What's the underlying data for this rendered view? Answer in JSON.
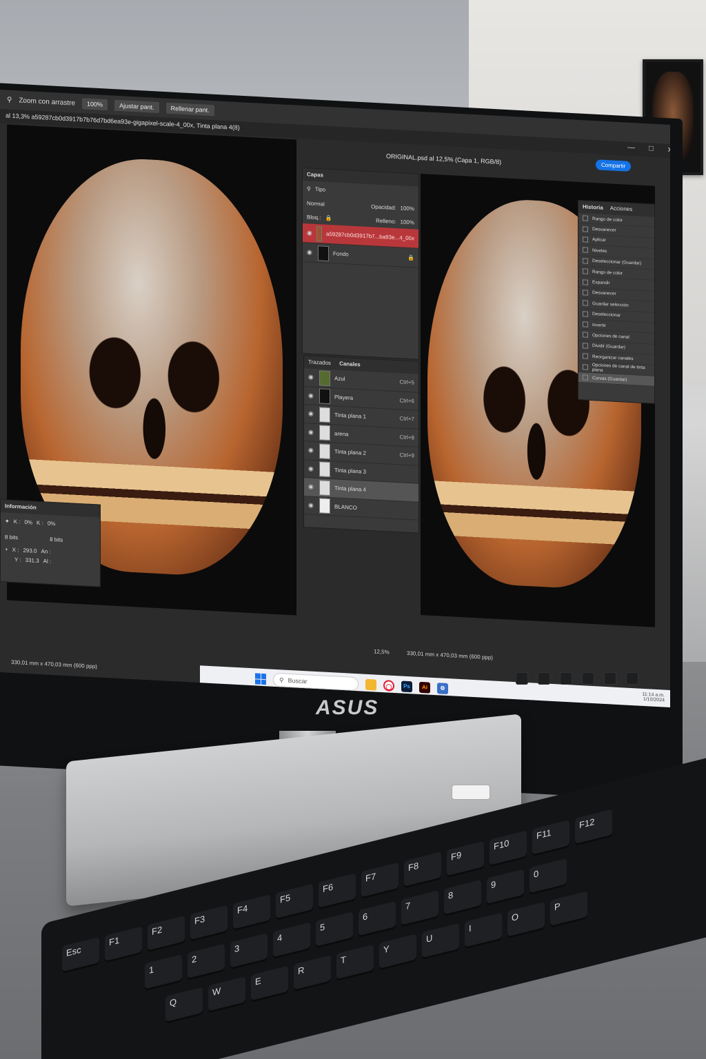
{
  "ps": {
    "options": {
      "zoom_drag_label": "Zoom con arrastre",
      "zoom_value": "100%",
      "fit_label": "Ajustar pant.",
      "fill_label": "Rellenar pant."
    },
    "tab_left": "al 13,3% a59287cb0d3917b7b76d7bd6ea93e-gigapixel-scale-4_00x, Tinta plana 4(8)",
    "doc_title": "ORIGINAL.psd al 12,5% (Capa 1, RGB/8)",
    "share_label": "Compartir",
    "layers": {
      "title": "Capas",
      "filter": "Tipo",
      "blend": "Normal",
      "opacity_label": "Opacidad:",
      "opacity_value": "100%",
      "lock_label": "Bloq.:",
      "fill_label": "Relleno:",
      "fill_value": "100%",
      "items": [
        {
          "name": "a59287cb0d3917b7...ba93e...4_00x"
        },
        {
          "name": "Fondo"
        }
      ]
    },
    "channels": {
      "tabs": [
        "Trazados",
        "Canales"
      ],
      "items": [
        {
          "name": "Azul",
          "shortcut": "Ctrl+5"
        },
        {
          "name": "Playera",
          "shortcut": "Ctrl+6"
        },
        {
          "name": "Tinta plana 1",
          "shortcut": "Ctrl+7"
        },
        {
          "name": "arena",
          "shortcut": "Ctrl+8"
        },
        {
          "name": "Tinta plana 2",
          "shortcut": "Ctrl+9"
        },
        {
          "name": "Tinta plana 3",
          "shortcut": ""
        },
        {
          "name": "Tinta plana 4",
          "shortcut": ""
        },
        {
          "name": "BLANCO",
          "shortcut": ""
        }
      ]
    },
    "history": {
      "tabs": [
        "Historia",
        "Acciones"
      ],
      "items": [
        "Rango de color",
        "Desvanecer",
        "Aplicar",
        "Niveles",
        "Deseleccionar (Guardar)",
        "Rango de color",
        "Expandir",
        "Desvanecer",
        "Guardar selección",
        "Deseleccionar",
        "Invertir",
        "Opciones de canal",
        "Dividir (Guardar)",
        "Reorganizar canales",
        "Opciones de canal de tinta plana",
        "Curvas (Guardar)"
      ]
    },
    "info": {
      "title": "Información",
      "k1": "K :",
      "k1_value": "0%",
      "k2": "K :",
      "k2_value": "0%",
      "bits1": "8 bits",
      "bits2": "8 bits",
      "x_label": "X :",
      "x_value": "293.0",
      "y_label": "Y :",
      "y_value": "331.3",
      "an_label": "An :",
      "al_label": "Al :"
    },
    "status_left": "330,01 mm x 470,03 mm (600 ppp)",
    "status_zoom": "12,5%",
    "status_right": "330,01 mm x 470,03 mm (600 ppp)"
  },
  "taskbar": {
    "search_placeholder": "Buscar",
    "apps": [
      "Ps",
      "Ai"
    ],
    "time": "11:14 a.m.",
    "date": "1/10/2024"
  },
  "hardware": {
    "brand": "ASUS"
  },
  "keyboard": {
    "row1": [
      "Esc",
      "F1",
      "F2",
      "F3",
      "F4",
      "F5",
      "F6",
      "F7",
      "F8",
      "F9",
      "F10",
      "F11",
      "F12"
    ],
    "row2": [
      "1",
      "2",
      "3",
      "4",
      "5",
      "6",
      "7",
      "8",
      "9",
      "0"
    ],
    "row3": [
      "Q",
      "W",
      "E",
      "R",
      "T",
      "Y",
      "U",
      "I",
      "O",
      "P"
    ]
  }
}
